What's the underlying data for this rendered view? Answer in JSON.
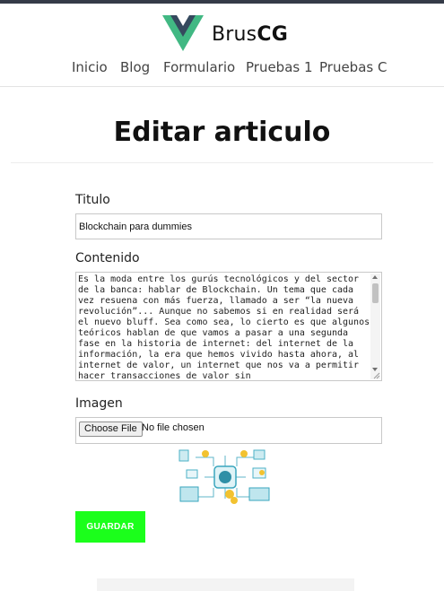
{
  "brand": {
    "name_regular": "Brus",
    "name_bold": "CG",
    "logo_colors": {
      "outer": "#41b883",
      "inner": "#35495e"
    }
  },
  "nav": {
    "items": [
      {
        "label": "Inicio"
      },
      {
        "label": "Blog"
      },
      {
        "label": "Formulario"
      },
      {
        "label": "Pruebas 1"
      },
      {
        "label": "Pruebas C"
      }
    ]
  },
  "page": {
    "title": "Editar articulo"
  },
  "form": {
    "title_label": "Titulo",
    "title_value": "Blockchain para dummies",
    "content_label": "Contenido",
    "content_value": "Es la moda entre los gurús tecnológicos y del sector de la banca: hablar de Blockchain. Un tema que cada vez resuena con más fuerza, llamado a ser “la nueva revolución”... Aunque no sabemos si en realidad será el nuevo bluff. Sea como sea, lo cierto es que algunos teóricos hablan de que vamos a pasar a una segunda fase en la historia de internet: del internet de la información, la era que hemos vivido hasta ahora, al internet de valor, un internet que nos va a permitir hacer transacciones de valor sin",
    "image_label": "Imagen",
    "file_button_label": "Choose File",
    "file_status": "No file chosen",
    "save_label": "GUARDAR"
  },
  "colors": {
    "save_button": "#1bff1b",
    "top_bar": "#353b48"
  },
  "icons": {
    "logo": "vue-logo-icon",
    "preview": "blockchain-illustration-icon"
  }
}
